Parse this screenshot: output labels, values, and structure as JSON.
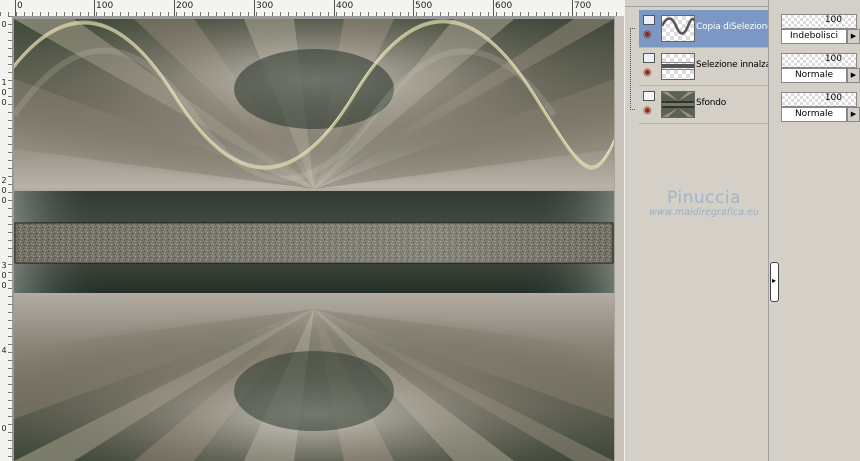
{
  "ruler": {
    "top_labels": [
      "0",
      "100",
      "200",
      "300",
      "400",
      "500",
      "600",
      "700"
    ],
    "left_labels": [
      "0",
      "1",
      "0",
      "0",
      "2",
      "0",
      "0",
      "3",
      "0",
      "0",
      "4",
      "0"
    ]
  },
  "layers": [
    {
      "name": "Copia diSelezione",
      "selected": true,
      "type": "vector"
    },
    {
      "name": "Selezione innalzata",
      "selected": false,
      "type": "vector"
    },
    {
      "name": "Sfondo",
      "selected": false,
      "type": "raster"
    }
  ],
  "properties": [
    {
      "opacity": "100",
      "blend": "Indebolisci"
    },
    {
      "opacity": "100",
      "blend": "Normale"
    },
    {
      "opacity": "100",
      "blend": "Normale"
    }
  ],
  "watermark": {
    "name": "Pinuccia",
    "url": "www.maidiregrafica.eu"
  },
  "icons": {
    "visibility": "eye-icon",
    "vector_layer": "vector-layer-icon",
    "raster_layer": "raster-layer-icon",
    "dropdown": "triangle-right-icon",
    "splitter": "chevron-right-icon"
  },
  "colors": {
    "selected_row": "#7b97c4",
    "panel_bg": "#d4d0c8",
    "watermark": "#a0b4cc"
  }
}
